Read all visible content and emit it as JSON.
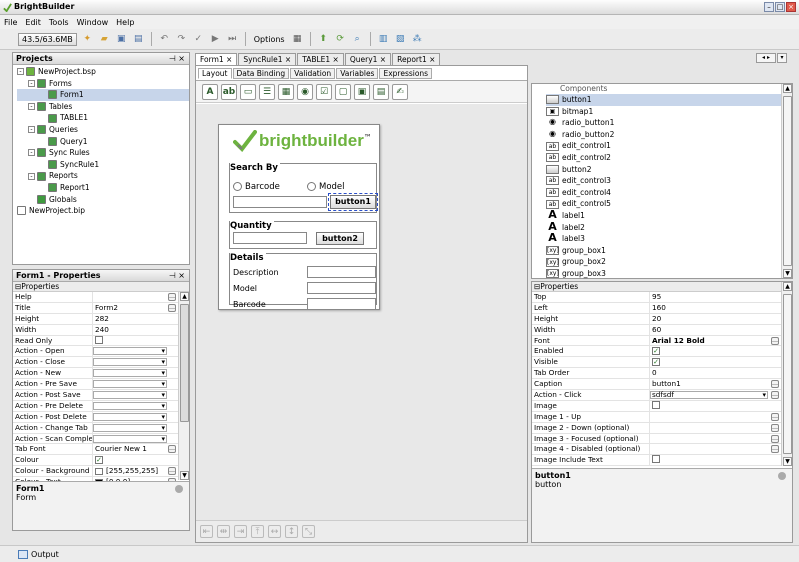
{
  "app": {
    "title": "BrightBuilder",
    "accent": "#4a7bb7"
  },
  "menu": [
    "File",
    "Edit",
    "Tools",
    "Window",
    "Help"
  ],
  "toolbar": {
    "memory": "43.5/63.6MB",
    "options_label": "Options"
  },
  "projects_panel": {
    "title": "Projects",
    "tree": [
      {
        "label": "NewProject.bsp",
        "level": 0,
        "icon": "project-icon",
        "toggle": "-"
      },
      {
        "label": "Forms",
        "level": 1,
        "icon": "forms-icon",
        "toggle": "-"
      },
      {
        "label": "Form1",
        "level": 2,
        "icon": "form-icon",
        "selected": true
      },
      {
        "label": "Tables",
        "level": 1,
        "icon": "tables-icon",
        "toggle": "-"
      },
      {
        "label": "TABLE1",
        "level": 2,
        "icon": "table-icon"
      },
      {
        "label": "Queries",
        "level": 1,
        "icon": "queries-icon",
        "toggle": "-"
      },
      {
        "label": "Query1",
        "level": 2,
        "icon": "query-icon"
      },
      {
        "label": "Sync Rules",
        "level": 1,
        "icon": "sync-rules-icon",
        "toggle": "-"
      },
      {
        "label": "SyncRule1",
        "level": 2,
        "icon": "sync-rule-icon"
      },
      {
        "label": "Reports",
        "level": 1,
        "icon": "reports-icon",
        "toggle": "-"
      },
      {
        "label": "Report1",
        "level": 2,
        "icon": "report-icon"
      },
      {
        "label": "Globals",
        "level": 1,
        "icon": "globals-icon"
      },
      {
        "label": "NewProject.bip",
        "level": 0,
        "icon": "file-icon"
      }
    ]
  },
  "form_properties": {
    "title": "Form1 - Properties",
    "section": "Properties",
    "rows": [
      {
        "k": "Help",
        "v": "",
        "t": "ell"
      },
      {
        "k": "Title",
        "v": "Form2",
        "t": "ell"
      },
      {
        "k": "Height",
        "v": "282",
        "t": "text"
      },
      {
        "k": "Width",
        "v": "240",
        "t": "text"
      },
      {
        "k": "Read Only",
        "v": "",
        "t": "cb"
      },
      {
        "k": "Action - Open",
        "v": "",
        "t": "dd"
      },
      {
        "k": "Action - Close",
        "v": "",
        "t": "dd"
      },
      {
        "k": "Action - New",
        "v": "",
        "t": "dd"
      },
      {
        "k": "Action - Pre Save",
        "v": "",
        "t": "dd"
      },
      {
        "k": "Action - Post Save",
        "v": "",
        "t": "dd"
      },
      {
        "k": "Action - Pre Delete",
        "v": "",
        "t": "dd"
      },
      {
        "k": "Action - Post Delete",
        "v": "",
        "t": "dd"
      },
      {
        "k": "Action - Change Tab",
        "v": "",
        "t": "dd"
      },
      {
        "k": "Action - Scan Complete",
        "v": "",
        "t": "dd"
      },
      {
        "k": "Tab Font",
        "v": "Courier New 1",
        "t": "ell"
      },
      {
        "k": "Colour",
        "v": "",
        "t": "cbx"
      },
      {
        "k": "Colour - Background",
        "v": "[255,255,255]",
        "t": "colw"
      },
      {
        "k": "Colour - Text",
        "v": "[0,0,0]",
        "t": "colb"
      }
    ],
    "footer_title": "Form1",
    "footer_desc": "Form"
  },
  "doc_tabs": [
    "Form1",
    "SyncRule1",
    "TABLE1",
    "Query1",
    "Report1"
  ],
  "sub_tabs": [
    "Layout",
    "Data Binding",
    "Validation",
    "Variables",
    "Expressions"
  ],
  "palette_icons": [
    "label-tool-icon",
    "edit-tool-icon",
    "button-tool-icon",
    "list-tool-icon",
    "grid-tool-icon",
    "radio-tool-icon",
    "checkbox-tool-icon",
    "group-tool-icon",
    "image-tool-icon",
    "picture-tool-icon",
    "signature-tool-icon"
  ],
  "form_preview": {
    "logo": "brightbuilder",
    "tm": "™",
    "search_by": "Search By",
    "barcode": "Barcode",
    "model": "Model",
    "button1": "button1",
    "quantity": "Quantity",
    "button2": "button2",
    "details": "Details",
    "description": "Description",
    "model2": "Model",
    "barcode2": "Barcode"
  },
  "components": {
    "header": "Components",
    "items": [
      {
        "label": "button1",
        "icon": "btn",
        "selected": true
      },
      {
        "label": "bitmap1",
        "icon": "bmp"
      },
      {
        "label": "radio_button1",
        "icon": "radio"
      },
      {
        "label": "radio_button2",
        "icon": "radio"
      },
      {
        "label": "edit_control1",
        "icon": "edit"
      },
      {
        "label": "edit_control2",
        "icon": "edit"
      },
      {
        "label": "button2",
        "icon": "btn"
      },
      {
        "label": "edit_control3",
        "icon": "edit"
      },
      {
        "label": "edit_control4",
        "icon": "edit"
      },
      {
        "label": "edit_control5",
        "icon": "edit"
      },
      {
        "label": "label1",
        "icon": "lbl"
      },
      {
        "label": "label2",
        "icon": "lbl"
      },
      {
        "label": "label3",
        "icon": "lbl"
      },
      {
        "label": "group_box1",
        "icon": "grp"
      },
      {
        "label": "group_box2",
        "icon": "grp"
      },
      {
        "label": "group_box3",
        "icon": "grp"
      }
    ]
  },
  "element_properties": {
    "section": "Properties",
    "rows": [
      {
        "k": "Top",
        "v": "95",
        "t": "text"
      },
      {
        "k": "Left",
        "v": "160",
        "t": "text"
      },
      {
        "k": "Height",
        "v": "20",
        "t": "text"
      },
      {
        "k": "Width",
        "v": "60",
        "t": "text"
      },
      {
        "k": "Font",
        "v": "Arial 12 Bold",
        "t": "bold"
      },
      {
        "k": "Enabled",
        "v": "",
        "t": "cbx"
      },
      {
        "k": "Visible",
        "v": "",
        "t": "cbx"
      },
      {
        "k": "Tab Order",
        "v": "0",
        "t": "text"
      },
      {
        "k": "Caption",
        "v": "button1",
        "t": "ell"
      },
      {
        "k": "Action - Click",
        "v": "sdfsdf",
        "t": "ddell"
      },
      {
        "k": "Image",
        "v": "",
        "t": "cb"
      },
      {
        "k": "Image 1 - Up",
        "v": "",
        "t": "ell"
      },
      {
        "k": "Image 2 - Down (optional)",
        "v": "",
        "t": "ell"
      },
      {
        "k": "Image 3 - Focused (optional)",
        "v": "",
        "t": "ell"
      },
      {
        "k": "Image 4 - Disabled (optional)",
        "v": "",
        "t": "ell"
      },
      {
        "k": "Image Include Text",
        "v": "",
        "t": "cb"
      }
    ],
    "footer_title": "button1",
    "footer_desc": "button"
  },
  "status": {
    "output": "Output"
  }
}
